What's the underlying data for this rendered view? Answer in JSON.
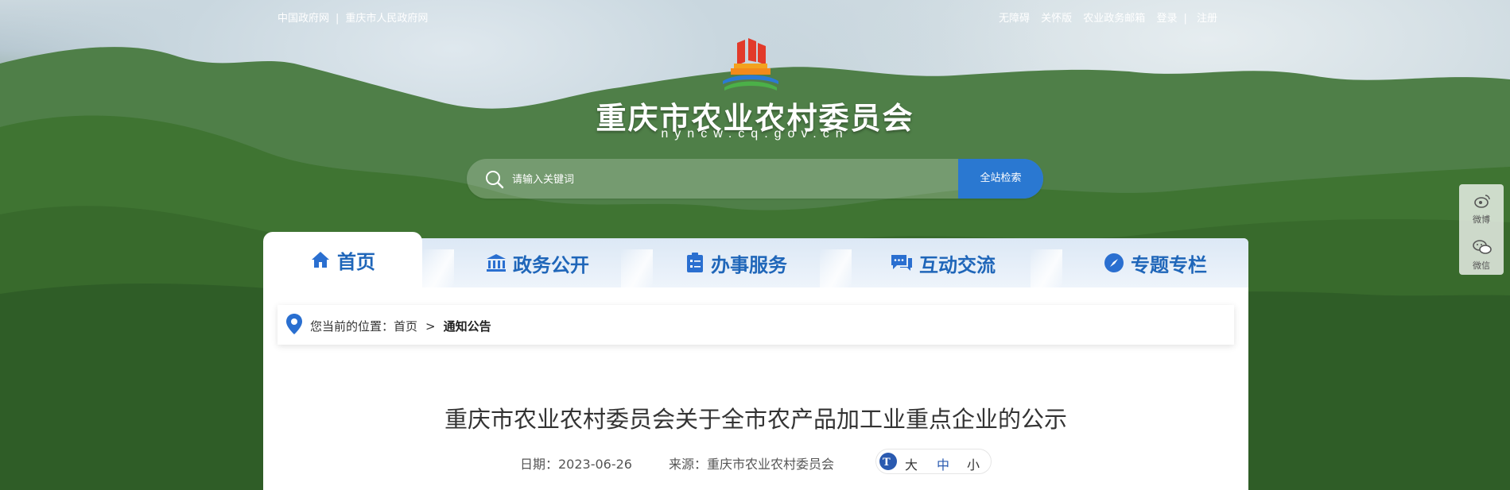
{
  "topbar": {
    "left_links": [
      "中国政府网",
      "重庆市人民政府网"
    ],
    "right_links": [
      "无障碍",
      "关怀版",
      "农业政务邮箱",
      "登录",
      "注册"
    ]
  },
  "site": {
    "title": "重庆市农业农村委员会",
    "domain": "nyncw.cq.gov.cn"
  },
  "search": {
    "placeholder": "请输入关键词",
    "button_label": "全站检索"
  },
  "nav": {
    "tabs": [
      {
        "label": "首页",
        "icon": "home-icon",
        "active": true
      },
      {
        "label": "政务公开",
        "icon": "building-icon",
        "active": false
      },
      {
        "label": "办事服务",
        "icon": "clipboard-icon",
        "active": false
      },
      {
        "label": "互动交流",
        "icon": "chat-icon",
        "active": false
      },
      {
        "label": "专题专栏",
        "icon": "compass-icon",
        "active": false
      }
    ]
  },
  "breadcrumb": {
    "prefix": "您当前的位置：",
    "home": "首页",
    "separator": ">",
    "current": "通知公告"
  },
  "article": {
    "title": "重庆市农业农村委员会关于全市农产品加工业重点企业的公示",
    "date": "日期：2023-06-26",
    "source": "来源：重庆市农业农村委员会",
    "font_sizes": [
      "大",
      "中",
      "小"
    ]
  },
  "share": {
    "weibo_label": "微博",
    "wechat_label": "微信"
  },
  "colors": {
    "accent": "#2a78d1",
    "nav_text": "#1f66b9"
  }
}
